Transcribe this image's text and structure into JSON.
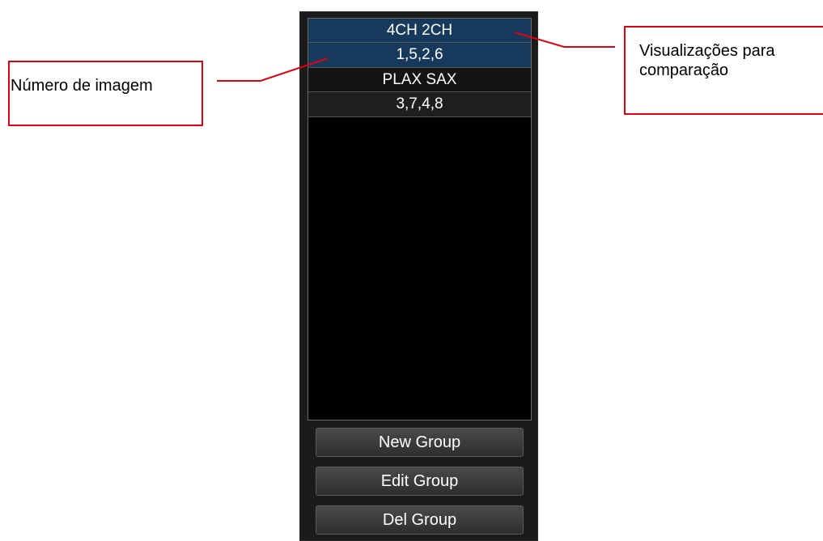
{
  "group_list": {
    "groups": [
      {
        "views": "4CH 2CH",
        "images": "1,5,2,6",
        "selected": true
      },
      {
        "views": "PLAX SAX",
        "images": "3,7,4,8",
        "selected": false
      }
    ]
  },
  "buttons": {
    "new_group": "New Group",
    "edit_group": "Edit Group",
    "del_group": "Del Group"
  },
  "callouts": {
    "image_number": "Número de imagem",
    "views_for_comparison": "Visualizações para comparação"
  },
  "colors": {
    "selected_row": "#17395b",
    "callout_border": "#e0000f",
    "panel_bg": "#1b1b1b"
  }
}
